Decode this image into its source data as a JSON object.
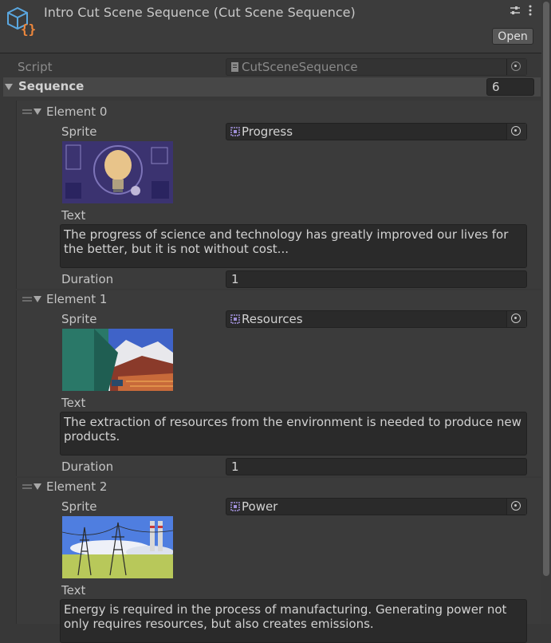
{
  "header": {
    "title": "Intro Cut Scene Sequence (Cut Scene Sequence)",
    "open_button": "Open",
    "icons": [
      "scriptable-object-icon",
      "preset-icon",
      "kebab-menu-icon"
    ]
  },
  "script_row": {
    "label": "Script",
    "value": "CutSceneSequence"
  },
  "sequence": {
    "label": "Sequence",
    "size": "6",
    "elements": [
      {
        "label": "Element 0",
        "sprite_label": "Sprite",
        "sprite_value": "Progress",
        "text_label": "Text",
        "text_value": "The progress of science and technology has greatly improved our lives for the better, but it is not without cost...",
        "duration_label": "Duration",
        "duration_value": "1"
      },
      {
        "label": "Element 1",
        "sprite_label": "Sprite",
        "sprite_value": "Resources",
        "text_label": "Text",
        "text_value": "The extraction of resources from the environment is needed to produce new products.",
        "duration_label": "Duration",
        "duration_value": "1"
      },
      {
        "label": "Element 2",
        "sprite_label": "Sprite",
        "sprite_value": "Power",
        "text_label": "Text",
        "text_value": "Energy is required in the process of manufacturing. Generating power not only requires resources, but also creates emissions."
      }
    ]
  },
  "colors": {
    "background": "#383838",
    "field": "#2a2a2a",
    "accent_orange": "#f0883c",
    "accent_blue": "#5aa7e0"
  }
}
